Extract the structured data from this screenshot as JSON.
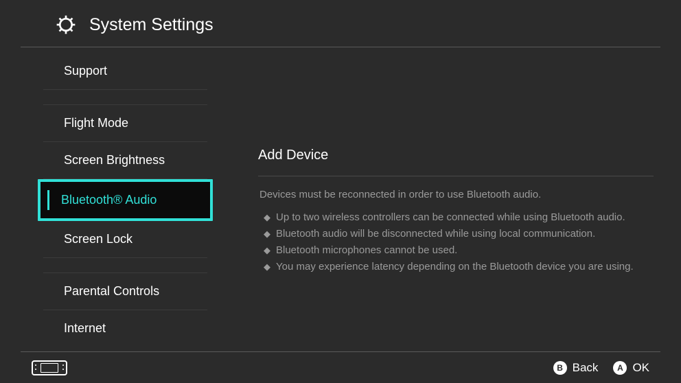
{
  "header": {
    "title": "System Settings"
  },
  "sidebar": {
    "items": [
      {
        "label": "Support"
      },
      {
        "label": "Flight Mode"
      },
      {
        "label": "Screen Brightness"
      },
      {
        "label": "Bluetooth® Audio",
        "selected": true
      },
      {
        "label": "Screen Lock"
      },
      {
        "label": "Parental Controls"
      },
      {
        "label": "Internet"
      }
    ]
  },
  "content": {
    "title": "Add Device",
    "subtitle": "Devices must be reconnected in order to use Bluetooth audio.",
    "bullets": [
      "Up to two wireless controllers can be connected while using Bluetooth audio.",
      "Bluetooth audio will be disconnected while using local communication.",
      "Bluetooth microphones cannot be used.",
      "You may experience latency depending on the Bluetooth device you are using."
    ]
  },
  "footer": {
    "back": {
      "button": "B",
      "label": "Back"
    },
    "ok": {
      "button": "A",
      "label": "OK"
    }
  }
}
